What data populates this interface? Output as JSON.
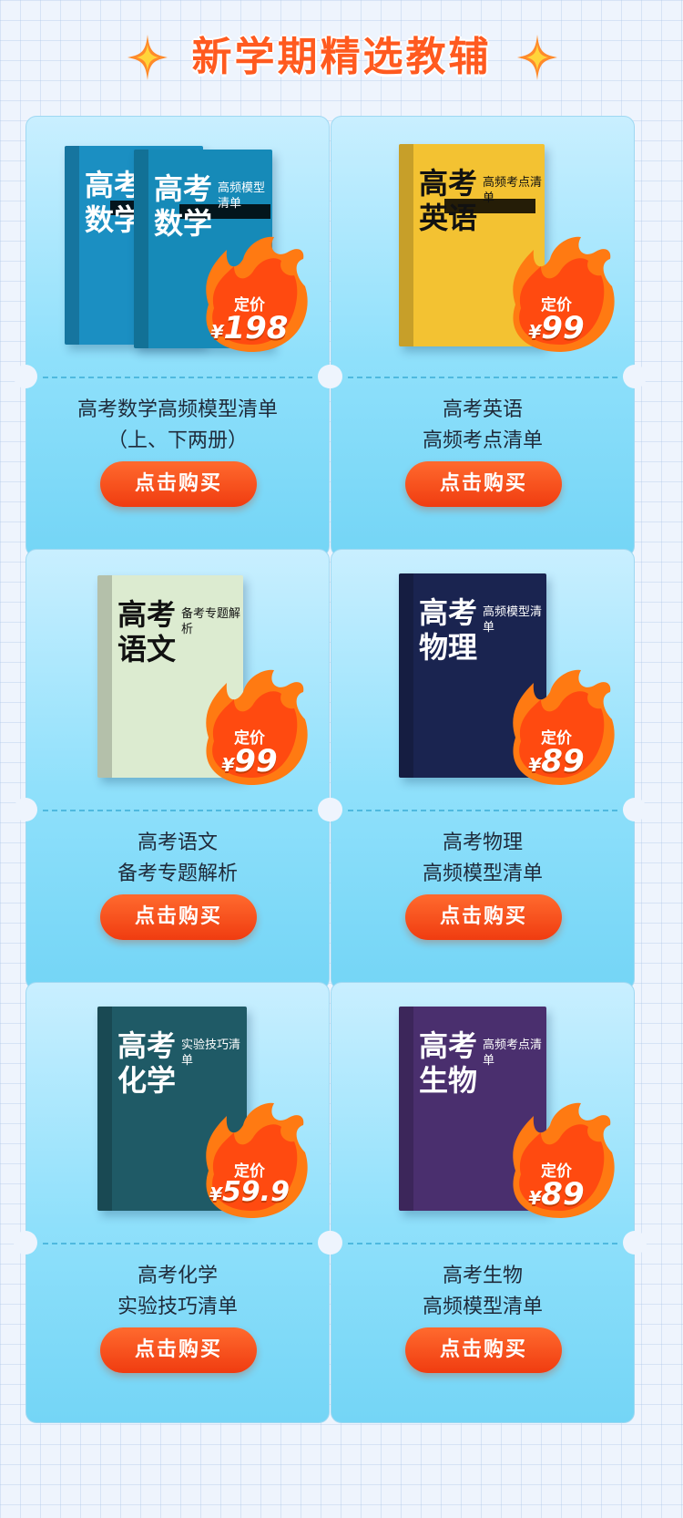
{
  "header": {
    "title": "新学期精选教辅"
  },
  "colors": {
    "accent": "#ff5a1f",
    "button": "#f4511e",
    "card": "#8fe0fb"
  },
  "books": [
    {
      "cover_title": "高考数学",
      "cover_sub": "高频模型清单",
      "cover_color": "#1b8fc2",
      "price_label": "定价",
      "price_currency": "¥",
      "price_value": "198",
      "name_line1": "高考数学高频模型清单",
      "name_line2": "（上、下两册）",
      "button": "点击购买"
    },
    {
      "cover_title": "高考英语",
      "cover_sub": "高频考点清单",
      "cover_color": "#f3c232",
      "price_label": "定价",
      "price_currency": "¥",
      "price_value": "99",
      "name_line1": "高考英语",
      "name_line2": "高频考点清单",
      "button": "点击购买"
    },
    {
      "cover_title": "高考语文",
      "cover_sub": "备考专题解析",
      "cover_color": "#dcebd0",
      "price_label": "定价",
      "price_currency": "¥",
      "price_value": "99",
      "name_line1": "高考语文",
      "name_line2": "备考专题解析",
      "button": "点击购买"
    },
    {
      "cover_title": "高考物理",
      "cover_sub": "高频模型清单",
      "cover_color": "#1a2450",
      "price_label": "定价",
      "price_currency": "¥",
      "price_value": "89",
      "name_line1": "高考物理",
      "name_line2": "高频模型清单",
      "button": "点击购买"
    },
    {
      "cover_title": "高考化学",
      "cover_sub": "实验技巧清单",
      "cover_color": "#1f5a66",
      "price_label": "定价",
      "price_currency": "¥",
      "price_value": "59.9",
      "name_line1": "高考化学",
      "name_line2": "实验技巧清单",
      "button": "点击购买"
    },
    {
      "cover_title": "高考生物",
      "cover_sub": "高频考点清单",
      "cover_color": "#4a2f6e",
      "price_label": "定价",
      "price_currency": "¥",
      "price_value": "89",
      "name_line1": "高考生物",
      "name_line2": "高频模型清单",
      "button": "点击购买"
    }
  ]
}
